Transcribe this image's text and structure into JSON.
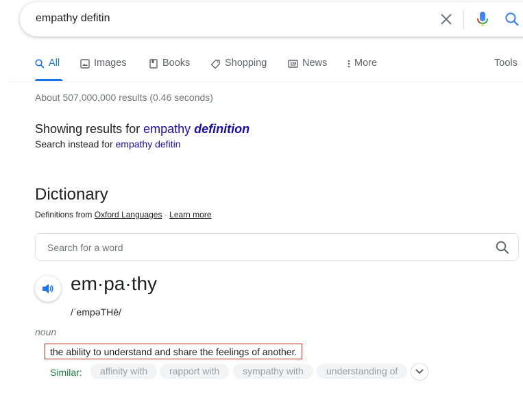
{
  "search": {
    "query": "empathy defitin"
  },
  "tabs": [
    {
      "label": "All",
      "icon": "search-icon",
      "active": true
    },
    {
      "label": "Images",
      "icon": "image-icon"
    },
    {
      "label": "Books",
      "icon": "book-icon"
    },
    {
      "label": "Shopping",
      "icon": "tag-icon"
    },
    {
      "label": "News",
      "icon": "newspaper-icon"
    },
    {
      "label": "More",
      "icon": "more-vertical-icon"
    }
  ],
  "tools_label": "Tools",
  "result_stats": "About 507,000,000 results (0.46 seconds)",
  "correction": {
    "prefix": "Showing results for",
    "word": "empathy",
    "corrected": "definition",
    "instead_prefix": "Search instead for",
    "instead_query": "empathy defitin"
  },
  "dictionary": {
    "title": "Dictionary",
    "source_prefix": "Definitions from",
    "source_name": "Oxford Languages",
    "separator": "·",
    "learn_more": "Learn more",
    "search_placeholder": "Search for a word",
    "headword": "em·pa·thy",
    "phonetic": "/ˈempəTHē/",
    "part_of_speech": "noun",
    "definition": "the ability to understand and share the feelings of another.",
    "similar_label": "Similar:",
    "similar": [
      "affinity with",
      "rapport with",
      "sympathy with",
      "understanding of"
    ]
  },
  "colors": {
    "accent": "#1a73e8",
    "link": "#1a0dab",
    "similar_green": "#188038",
    "highlight_border": "#c5221f"
  }
}
